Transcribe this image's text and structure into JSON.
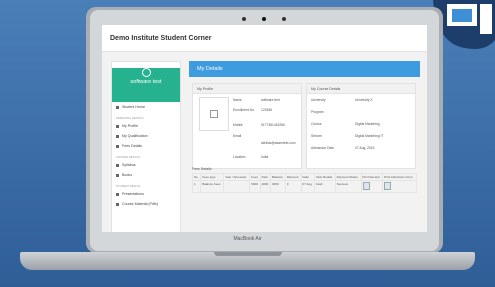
{
  "app": {
    "title": "Demo Institute Student Corner",
    "brand_name": "software test",
    "device_label": "MacBook Air"
  },
  "sidebar": {
    "items": [
      {
        "label": "Student Home",
        "icon": "home-icon"
      },
      {
        "section": "Personal Details"
      },
      {
        "label": "My Profile",
        "icon": "user-icon"
      },
      {
        "label": "My Qualification",
        "icon": "qualification-icon"
      },
      {
        "label": "Fees Details",
        "icon": "fees-icon"
      },
      {
        "section": "Course Details"
      },
      {
        "label": "Syllabus",
        "icon": "syllabus-icon"
      },
      {
        "label": "Books",
        "icon": "book-icon"
      },
      {
        "section": "Student Result"
      },
      {
        "label": "Presentations",
        "icon": "presentation-icon"
      },
      {
        "label": "Course Material (Pdfs)",
        "icon": "pdf-icon"
      }
    ]
  },
  "main": {
    "header": "My Details",
    "profile": {
      "title": "My Profile",
      "fields": [
        {
          "k": "Name",
          "v": "software test"
        },
        {
          "k": "Enrollment No.",
          "v": "123456"
        },
        {
          "k": "Mobile",
          "v": "9177381415256"
        },
        {
          "k": "Email",
          "v": "abhilas@aasertest.com"
        },
        {
          "k": "Location",
          "v": "India"
        }
      ]
    },
    "course": {
      "title": "My Course Details",
      "fields": [
        {
          "k": "University",
          "v": "University X"
        },
        {
          "k": "Program",
          "v": ""
        },
        {
          "k": "Course",
          "v": "Digital Marketing"
        },
        {
          "k": "Stream",
          "v": "Digital Marketing IT"
        },
        {
          "k": "Admission Date",
          "v": "07 Aug, 2015"
        }
      ]
    },
    "fees": {
      "title": "Fees Details",
      "headers": [
        "No.",
        "Fees type",
        "Year / Semester",
        "Fees",
        "Paid",
        "Balance",
        "Discount",
        "Date",
        "View Details",
        "Payment Status",
        "Print Receipt",
        "Print Admission Form"
      ],
      "rows": [
        [
          "1",
          "Balance Fees",
          "",
          "5000",
          "2000",
          "3000",
          "0",
          "07 Aug",
          "Cash",
          "Success",
          "",
          ""
        ]
      ]
    }
  }
}
